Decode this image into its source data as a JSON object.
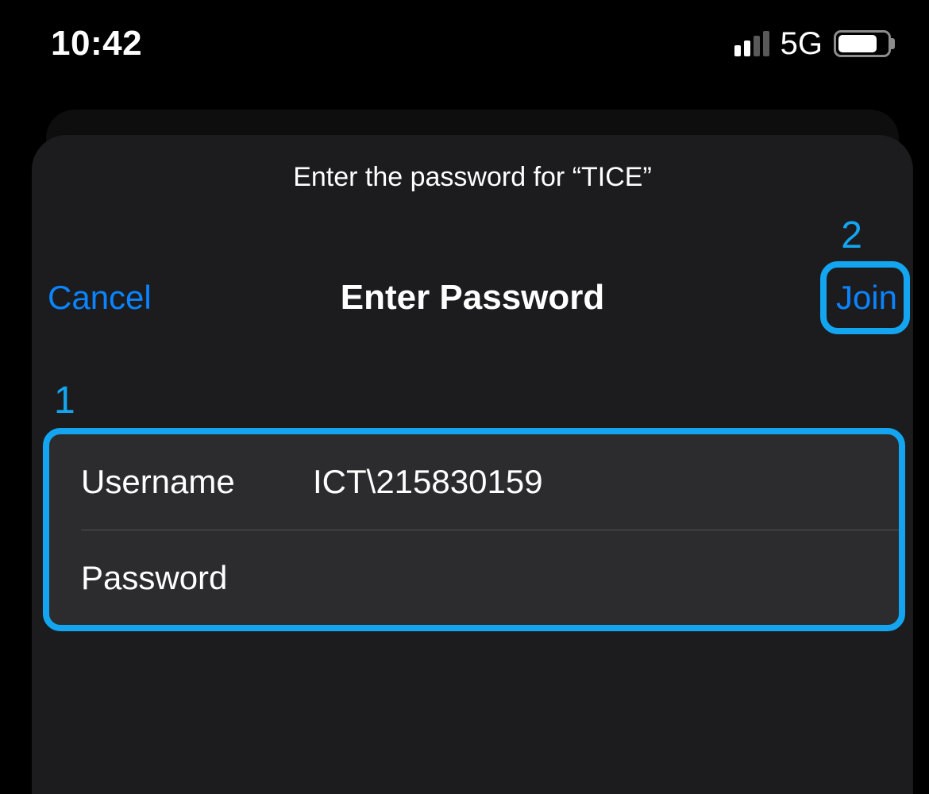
{
  "status": {
    "time": "10:42",
    "signal_bars_on": 2,
    "network": "5G",
    "battery_pct": 80
  },
  "sheet": {
    "subtitle": "Enter the password for “TICE”",
    "cancel_label": "Cancel",
    "title": "Enter Password",
    "join_label": "Join"
  },
  "form": {
    "username_label": "Username",
    "username_value": "ICT\\215830159",
    "password_label": "Password",
    "password_value": ""
  },
  "annotations": {
    "num1": "1",
    "num2": "2",
    "highlight_color": "#14a5f0"
  }
}
